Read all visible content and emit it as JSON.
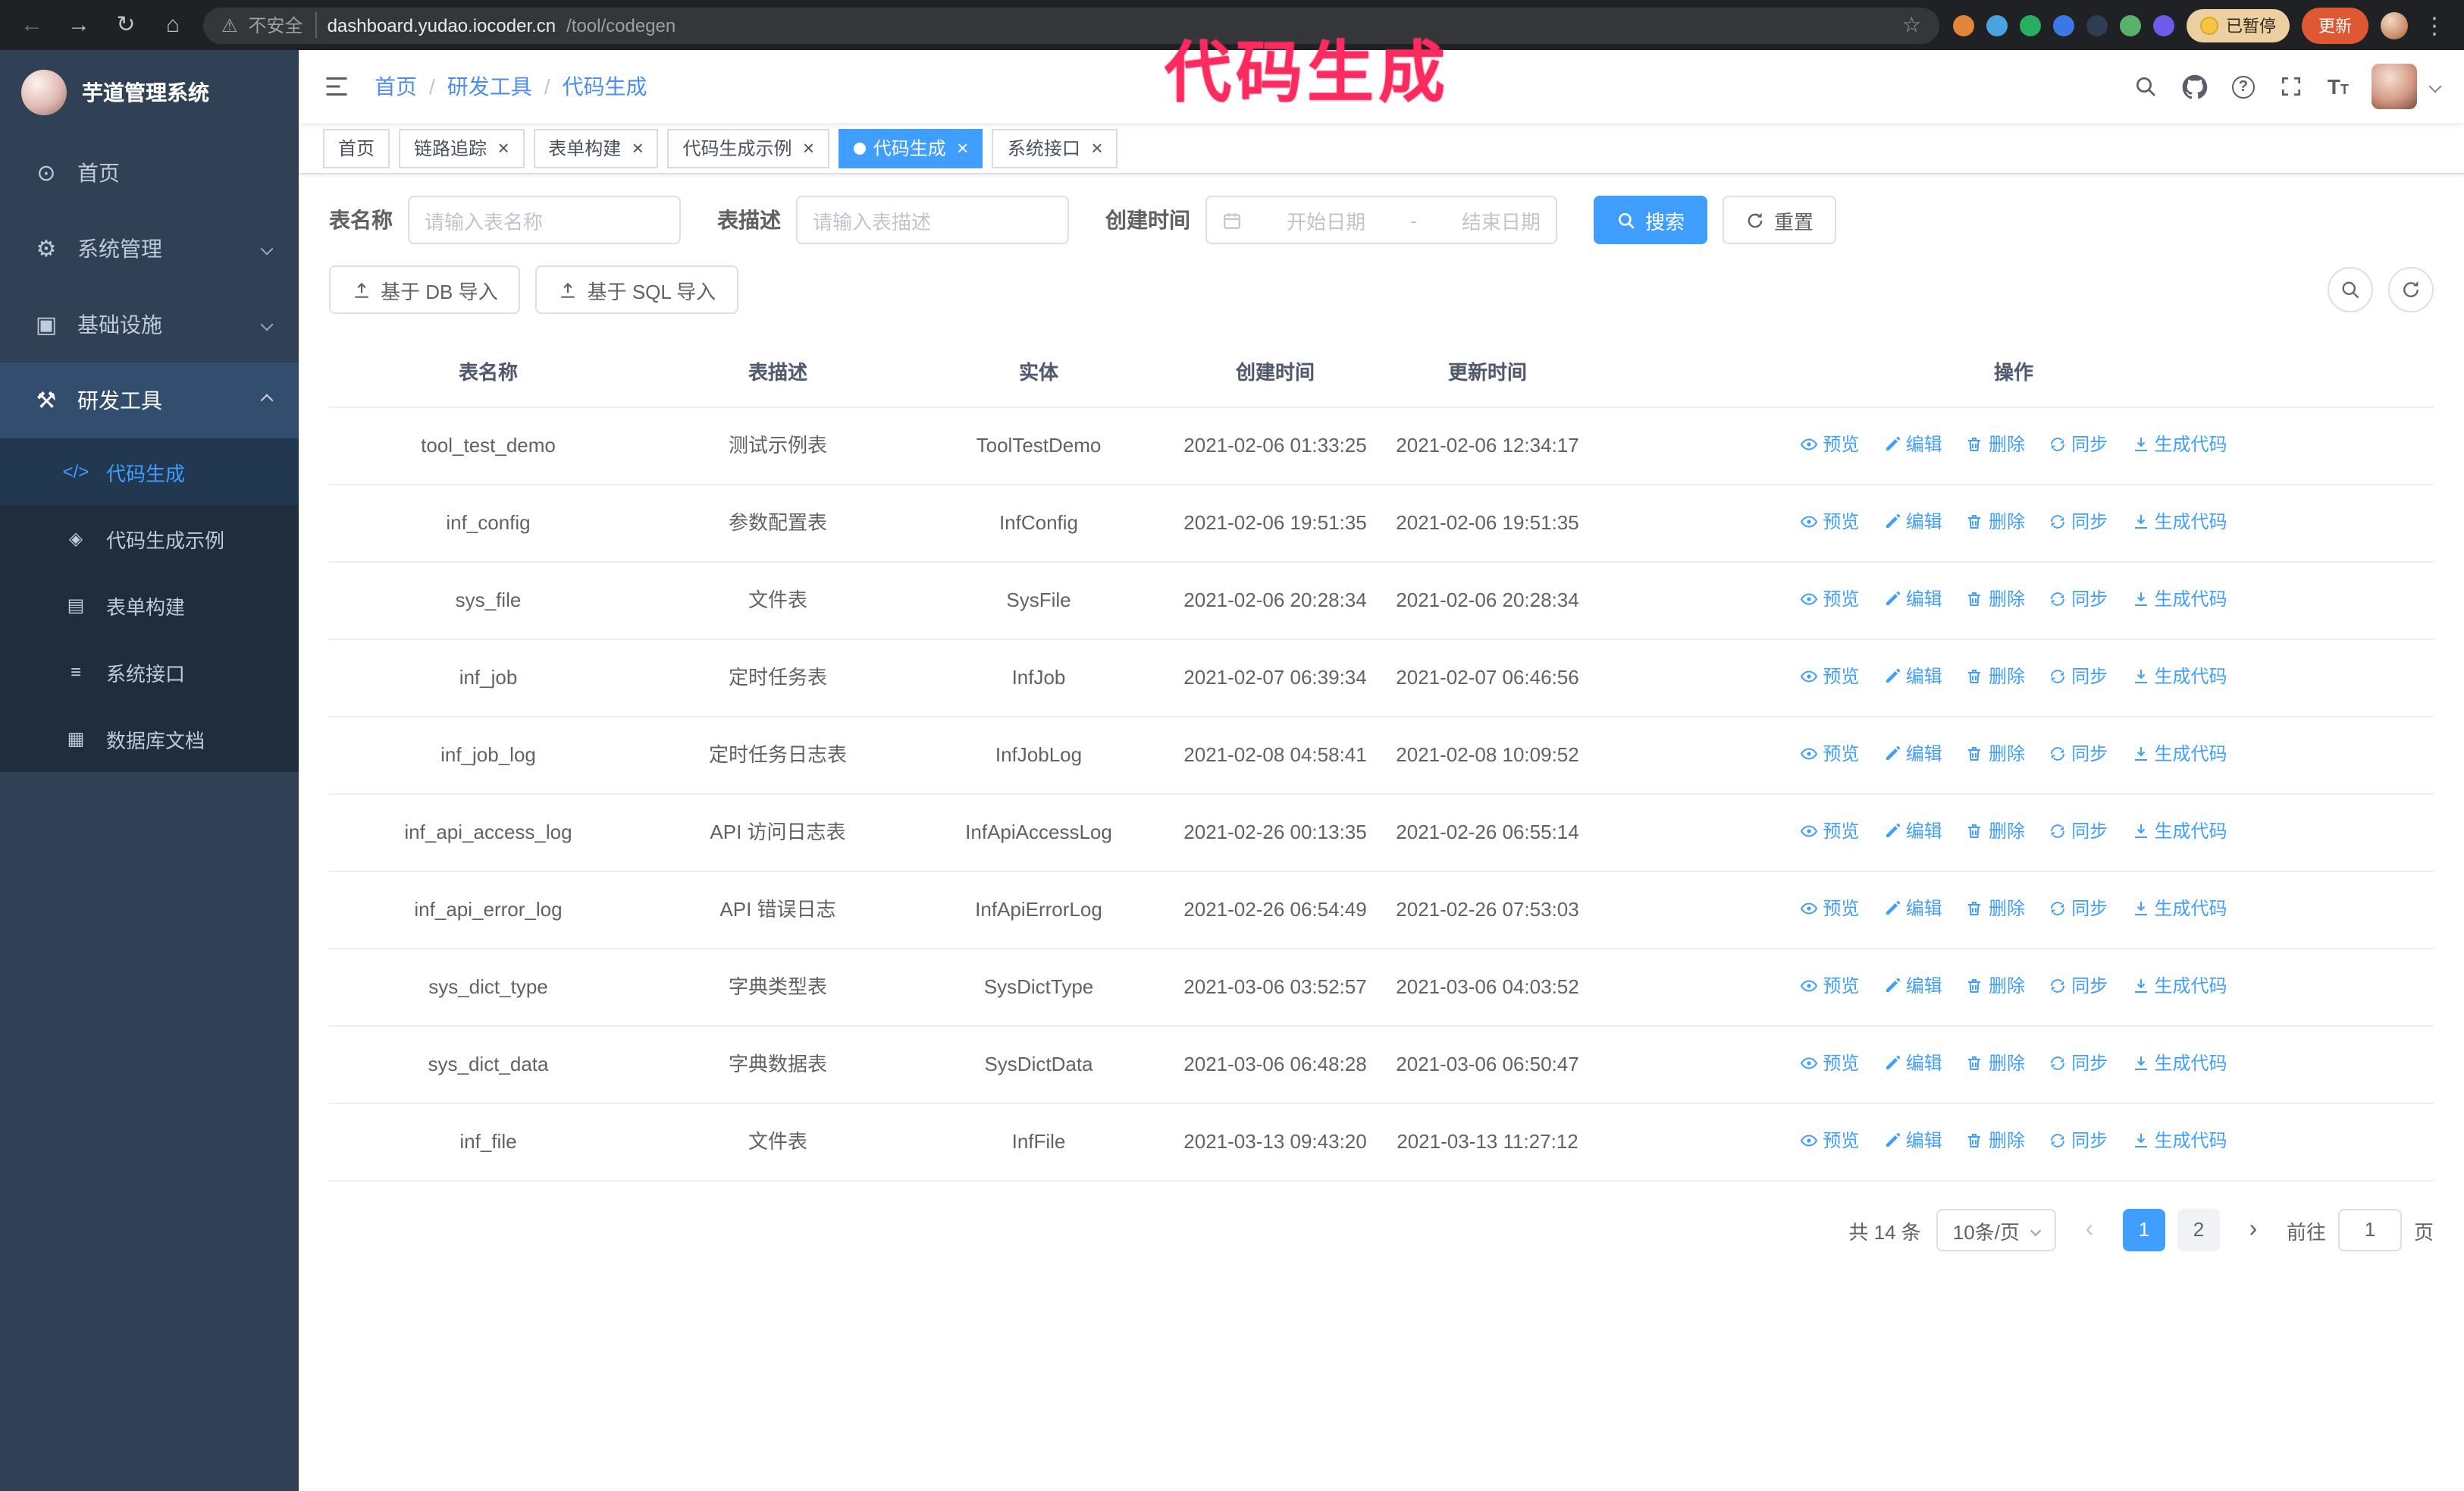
{
  "theme": {
    "accent": "#409eff",
    "sidebar_bg": "#304156",
    "submenu_bg": "#1f2d3d",
    "chrome_bg": "#202124",
    "annotation_color": "#fb2b5f",
    "update_button_color": "#de5833"
  },
  "annotation": {
    "text": "代码生成"
  },
  "icons": {
    "back": "←",
    "forward": "→",
    "reload": "↻",
    "home": "⌂",
    "warning": "⚠",
    "star": "☆",
    "menu": "⋮",
    "close": "×",
    "question": "?",
    "prev": "‹",
    "next": "›",
    "caret": "▾"
  },
  "browser": {
    "security_label": "不安全",
    "url_host": "dashboard.yudao.iocoder.cn",
    "url_path": "/tool/codegen",
    "paused_badge": "已暂停",
    "update_button": "更新",
    "extensions": [
      {
        "name": "extension-icon-1",
        "color": "#e2863c"
      },
      {
        "name": "extension-icon-2",
        "color": "#4aa3df"
      },
      {
        "name": "extension-icon-3",
        "color": "#27ae60"
      },
      {
        "name": "extension-icon-4",
        "color": "#3b78e7"
      },
      {
        "name": "extension-icon-5",
        "color": "#2c3e50"
      },
      {
        "name": "extension-icon-6",
        "color": "#58b368"
      },
      {
        "name": "extension-icon-7",
        "color": "#6c5ce7"
      }
    ]
  },
  "sidebar": {
    "app_title": "芋道管理系统",
    "items": [
      {
        "label": "首页",
        "icon": "⊙"
      },
      {
        "label": "系统管理",
        "icon": "⚙"
      },
      {
        "label": "基础设施",
        "icon": "▣"
      },
      {
        "label": "研发工具",
        "icon": "⚒"
      }
    ],
    "subitems": [
      {
        "label": "代码生成",
        "icon": "</>",
        "active": true
      },
      {
        "label": "代码生成示例",
        "icon": "◈"
      },
      {
        "label": "表单构建",
        "icon": "▤"
      },
      {
        "label": "系统接口",
        "icon": "≡"
      },
      {
        "label": "数据库文档",
        "icon": "▦"
      }
    ]
  },
  "header": {
    "breadcrumb": [
      {
        "label": "首页"
      },
      {
        "label": "研发工具"
      },
      {
        "label": "代码生成"
      }
    ]
  },
  "tabs": {
    "items": [
      {
        "label": "首页",
        "affix": true
      },
      {
        "label": "链路追踪"
      },
      {
        "label": "表单构建"
      },
      {
        "label": "代码生成示例"
      },
      {
        "label": "代码生成",
        "active": true
      },
      {
        "label": "系统接口"
      }
    ]
  },
  "filters": {
    "name_label": "表名称",
    "name_placeholder": "请输入表名称",
    "desc_label": "表描述",
    "desc_placeholder": "请输入表描述",
    "date_label": "创建时间",
    "date_start": "开始日期",
    "date_separator": "-",
    "date_end": "结束日期",
    "search_button": "搜索",
    "reset_button": "重置"
  },
  "toolbar": {
    "import_db": "基于 DB 导入",
    "import_sql": "基于 SQL 导入"
  },
  "table": {
    "headers": {
      "name": "表名称",
      "desc": "表描述",
      "entity": "实体",
      "created": "创建时间",
      "updated": "更新时间",
      "ops": "操作"
    },
    "ops": {
      "preview": "预览",
      "edit": "编辑",
      "delete": "删除",
      "sync": "同步",
      "generate": "生成代码"
    },
    "rows": [
      {
        "name": "tool_test_demo",
        "desc": "测试示例表",
        "entity": "ToolTestDemo",
        "created": "2021-02-06 01:33:25",
        "updated": "2021-02-06 12:34:17"
      },
      {
        "name": "inf_config",
        "desc": "参数配置表",
        "entity": "InfConfig",
        "created": "2021-02-06 19:51:35",
        "updated": "2021-02-06 19:51:35"
      },
      {
        "name": "sys_file",
        "desc": "文件表",
        "entity": "SysFile",
        "created": "2021-02-06 20:28:34",
        "updated": "2021-02-06 20:28:34"
      },
      {
        "name": "inf_job",
        "desc": "定时任务表",
        "entity": "InfJob",
        "created": "2021-02-07 06:39:34",
        "updated": "2021-02-07 06:46:56"
      },
      {
        "name": "inf_job_log",
        "desc": "定时任务日志表",
        "entity": "InfJobLog",
        "created": "2021-02-08 04:58:41",
        "updated": "2021-02-08 10:09:52"
      },
      {
        "name": "inf_api_access_log",
        "desc": "API 访问日志表",
        "entity": "InfApiAccessLog",
        "created": "2021-02-26 00:13:35",
        "updated": "2021-02-26 06:55:14"
      },
      {
        "name": "inf_api_error_log",
        "desc": "API 错误日志",
        "entity": "InfApiErrorLog",
        "created": "2021-02-26 06:54:49",
        "updated": "2021-02-26 07:53:03"
      },
      {
        "name": "sys_dict_type",
        "desc": "字典类型表",
        "entity": "SysDictType",
        "created": "2021-03-06 03:52:57",
        "updated": "2021-03-06 04:03:52"
      },
      {
        "name": "sys_dict_data",
        "desc": "字典数据表",
        "entity": "SysDictData",
        "created": "2021-03-06 06:48:28",
        "updated": "2021-03-06 06:50:47"
      },
      {
        "name": "inf_file",
        "desc": "文件表",
        "entity": "InfFile",
        "created": "2021-03-13 09:43:20",
        "updated": "2021-03-13 11:27:12"
      }
    ]
  },
  "pagination": {
    "total": "共 14 条",
    "page_size": "10条/页",
    "pages": [
      {
        "label": "1",
        "active": true
      },
      {
        "label": "2"
      }
    ],
    "goto_label": "前往",
    "goto_value": "1",
    "goto_unit": "页"
  }
}
